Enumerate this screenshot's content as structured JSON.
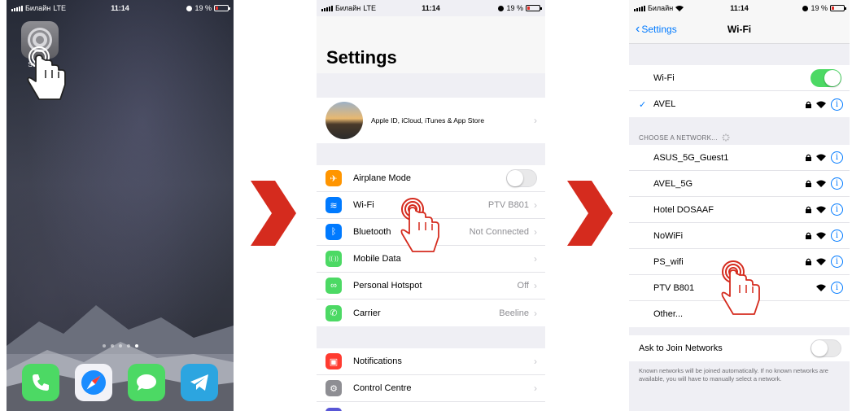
{
  "colors": {
    "accent": "#007aff",
    "arrow_red": "#d52b1e",
    "toggle_on": "#4cd964"
  },
  "home": {
    "status": {
      "carrier": "Билайн",
      "network": "LTE",
      "time": "11:14",
      "battery": "19 %"
    },
    "settings_app_label": "Settings",
    "dock_apps": [
      {
        "icon": "phone-icon",
        "color": "#4cd964"
      },
      {
        "icon": "safari-icon",
        "color": "#1a8cff"
      },
      {
        "icon": "messages-icon",
        "color": "#4cd964"
      },
      {
        "icon": "telegram-icon",
        "color": "#2ca5e0"
      }
    ]
  },
  "settings": {
    "status": {
      "carrier": "Билайн",
      "network": "LTE",
      "time": "11:14",
      "battery": "19 %"
    },
    "title": "Settings",
    "apple_id": "Apple ID, iCloud, iTunes & App Store",
    "rows": [
      {
        "label": "Airplane Mode",
        "value": "",
        "icon": "airplane-icon",
        "color": "#ff9500",
        "glyph": "✈"
      },
      {
        "label": "Wi-Fi",
        "value": "PTV B801",
        "icon": "wifi-icon",
        "color": "#007aff",
        "glyph": "≋"
      },
      {
        "label": "Bluetooth",
        "value": "Not Connected",
        "icon": "bluetooth-icon",
        "color": "#007aff",
        "glyph": "ᛒ"
      },
      {
        "label": "Mobile Data",
        "value": "",
        "icon": "antenna-icon",
        "color": "#4cd964",
        "glyph": "((·))"
      },
      {
        "label": "Personal Hotspot",
        "value": "Off",
        "icon": "hotspot-icon",
        "color": "#4cd964",
        "glyph": "∞"
      },
      {
        "label": "Carrier",
        "value": "Beeline",
        "icon": "phone-icon",
        "color": "#4cd964",
        "glyph": "✆"
      }
    ],
    "rows2": [
      {
        "label": "Notifications",
        "icon": "notifications-icon",
        "color": "#ff3b30",
        "glyph": "▣"
      },
      {
        "label": "Control Centre",
        "icon": "control-centre-icon",
        "color": "#8e8e93",
        "glyph": "⚙"
      }
    ]
  },
  "wifi": {
    "status": {
      "carrier": "Билайн",
      "time": "11:14",
      "battery": "19 %"
    },
    "back_label": "Settings",
    "title": "Wi-Fi",
    "wifi_label": "Wi-Fi",
    "connected": "AVEL",
    "choose_header": "CHOOSE A NETWORK...",
    "networks": [
      {
        "name": "ASUS_5G_Guest1",
        "locked": true
      },
      {
        "name": "AVEL_5G",
        "locked": true
      },
      {
        "name": "Hotel DOSAAF",
        "locked": true
      },
      {
        "name": "NoWiFi",
        "locked": true
      },
      {
        "name": "PS_wifi",
        "locked": true
      },
      {
        "name": "PTV B801",
        "locked": false
      }
    ],
    "other_label": "Other...",
    "ask_label": "Ask to Join Networks",
    "footnote": "Known networks will be joined automatically. If no known networks are available, you will have to manually select a network."
  }
}
